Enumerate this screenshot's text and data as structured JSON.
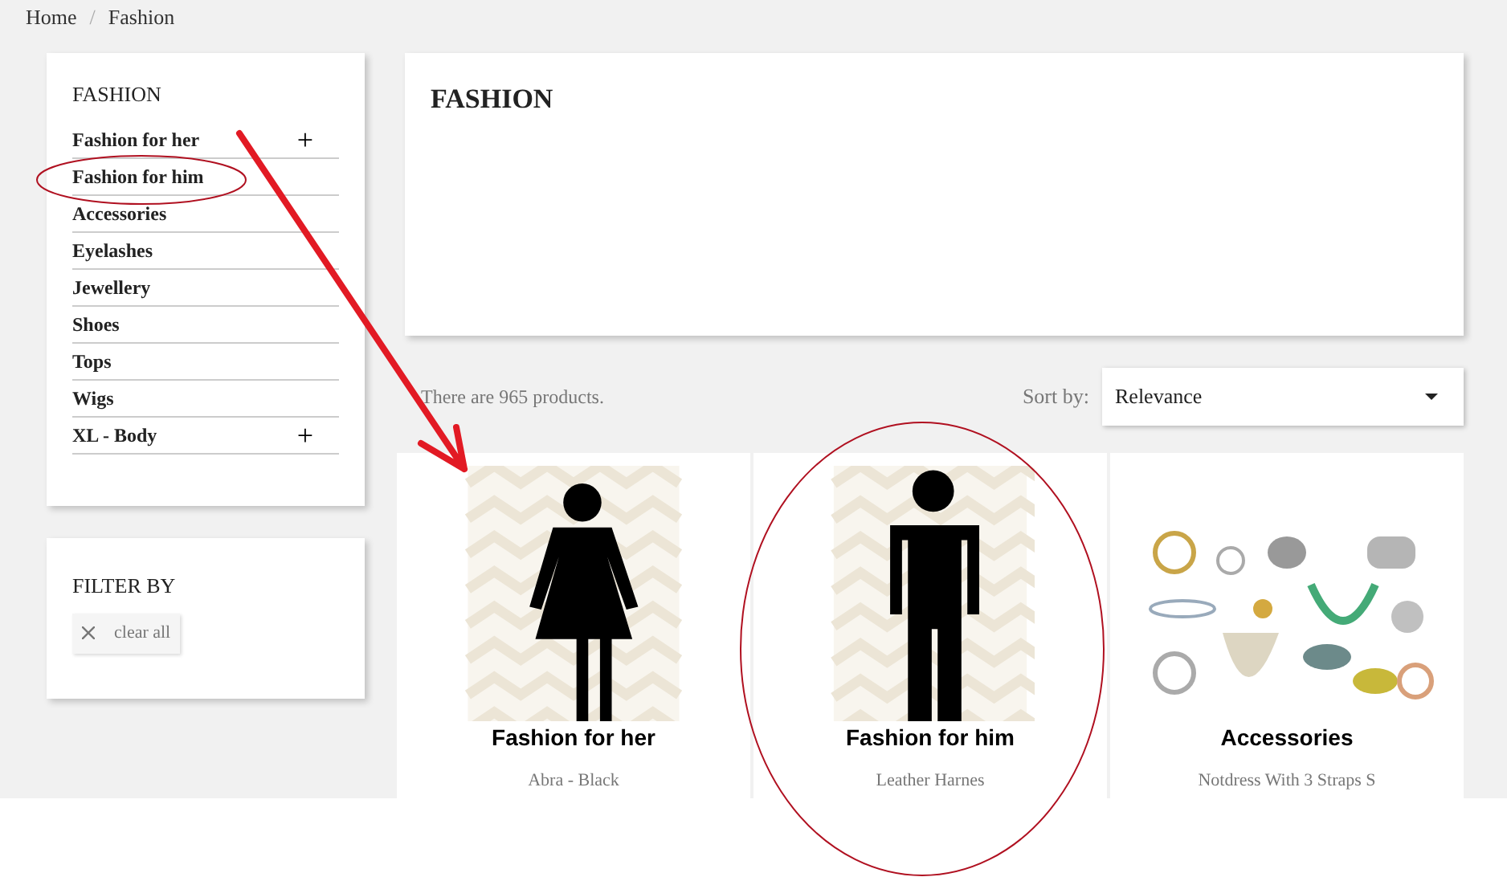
{
  "breadcrumb": [
    "Home",
    "Fashion"
  ],
  "breadcrumb_separator": "/",
  "expand_symbol": "+",
  "categories": {
    "title": "FASHION",
    "items": [
      {
        "label": "Fashion for her",
        "expandable": true
      },
      {
        "label": "Fashion for him",
        "expandable": false
      },
      {
        "label": "Accessories",
        "expandable": false
      },
      {
        "label": "Eyelashes",
        "expandable": false
      },
      {
        "label": "Jewellery",
        "expandable": false
      },
      {
        "label": "Shoes",
        "expandable": false
      },
      {
        "label": "Tops",
        "expandable": false
      },
      {
        "label": "Wigs",
        "expandable": false
      },
      {
        "label": "XL - Body",
        "expandable": true
      }
    ]
  },
  "filter": {
    "title": "FILTER BY",
    "clear": "clear all"
  },
  "header": {
    "title": "FASHION"
  },
  "product_count": "There are 965 products.",
  "sort": {
    "label": "Sort by:",
    "value": "Relevance"
  },
  "products": [
    {
      "kind": "woman",
      "caption": "Fashion for her",
      "name": "Abra - Black"
    },
    {
      "kind": "man",
      "caption": "Fashion for him",
      "name": "Leather Harnes"
    },
    {
      "kind": "jewellery",
      "caption": "Accessories",
      "name": "Notdress With 3 Straps S"
    }
  ]
}
